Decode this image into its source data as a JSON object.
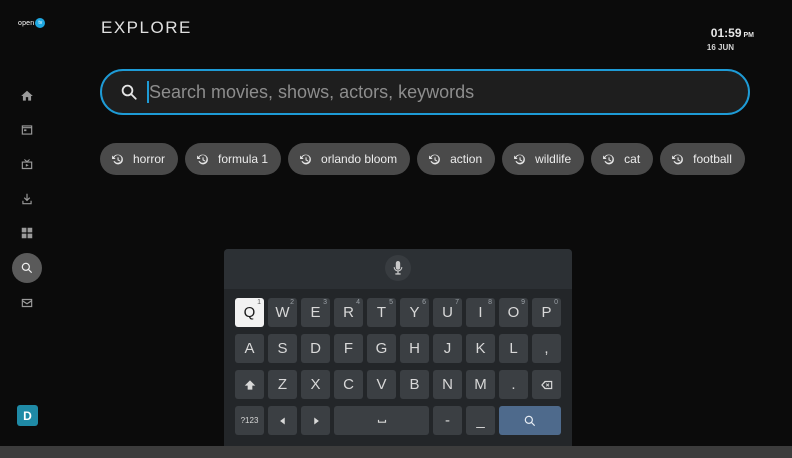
{
  "app": {
    "logo_text": "open",
    "logo_badge": "tv"
  },
  "sidebar": {
    "items": [
      {
        "icon": "home-icon",
        "active": false
      },
      {
        "icon": "guide-icon",
        "active": false
      },
      {
        "icon": "tv-icon",
        "active": false
      },
      {
        "icon": "download-icon",
        "active": false
      },
      {
        "icon": "apps-grid-icon",
        "active": false
      },
      {
        "icon": "search-icon",
        "active": true
      },
      {
        "icon": "mail-icon",
        "active": false
      }
    ],
    "profile_initial": "D"
  },
  "header": {
    "title": "EXPLORE",
    "time": "01:59",
    "ampm": "PM",
    "date": "16 JUN"
  },
  "search": {
    "placeholder": "Search movies, shows, actors, keywords",
    "value": ""
  },
  "recent_searches": [
    "horror",
    "formula 1",
    "orlando bloom",
    "action",
    "wildlife",
    "cat",
    "football"
  ],
  "keyboard": {
    "row1": [
      {
        "k": "Q",
        "s": "1"
      },
      {
        "k": "W",
        "s": "2"
      },
      {
        "k": "E",
        "s": "3"
      },
      {
        "k": "R",
        "s": "4"
      },
      {
        "k": "T",
        "s": "5"
      },
      {
        "k": "Y",
        "s": "6"
      },
      {
        "k": "U",
        "s": "7"
      },
      {
        "k": "I",
        "s": "8"
      },
      {
        "k": "O",
        "s": "9"
      },
      {
        "k": "P",
        "s": "0"
      }
    ],
    "row2": [
      "A",
      "S",
      "D",
      "F",
      "G",
      "H",
      "J",
      "K",
      "L",
      ","
    ],
    "row3": [
      "Z",
      "X",
      "C",
      "V",
      "B",
      "N",
      "M",
      "."
    ],
    "row4": {
      "symbols": "?123",
      "dash": "-",
      "underscore": "_"
    },
    "focused_key": "Q"
  },
  "colors": {
    "accent": "#1e9bd6",
    "background": "#0b0b0b",
    "chip_bg": "#4a4a4a",
    "avatar": "#1f8aa6",
    "search_key": "#4e6a8c"
  }
}
